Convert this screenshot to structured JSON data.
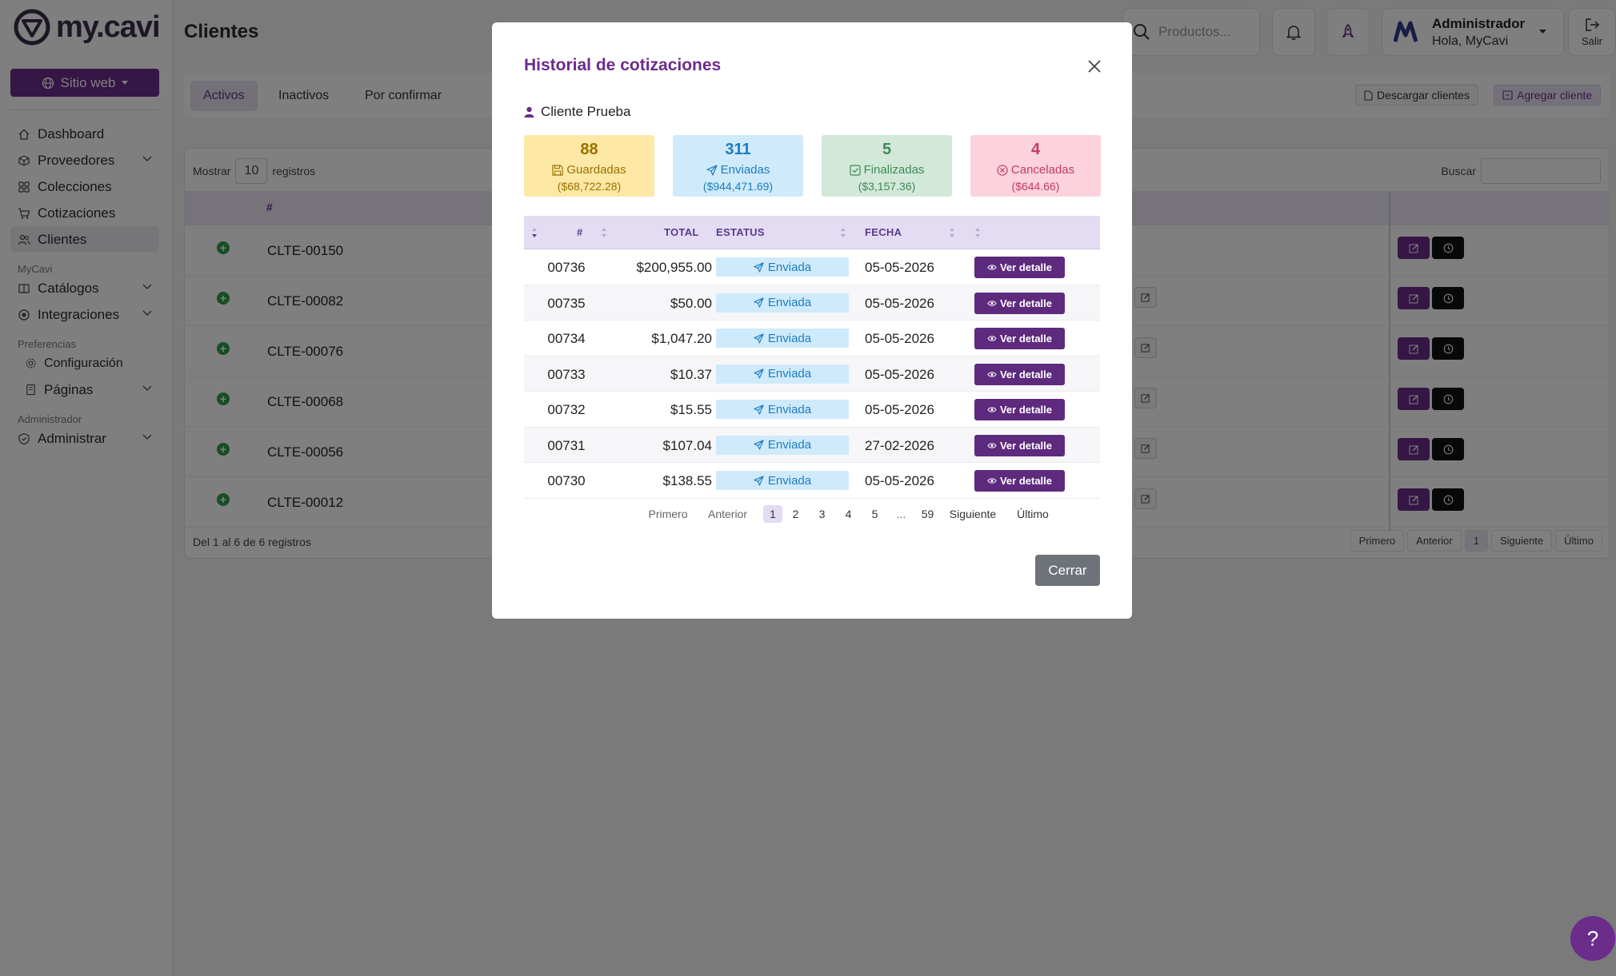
{
  "brand": {
    "logo_text": "my.cavi",
    "accent": "#6b2c8a"
  },
  "sidebar": {
    "site_button": "Sitio web",
    "items": [
      {
        "label": "Dashboard",
        "icon": "home-icon"
      },
      {
        "label": "Proveedores",
        "icon": "box-icon",
        "expandable": true
      },
      {
        "label": "Colecciones",
        "icon": "grid-icon"
      },
      {
        "label": "Cotizaciones",
        "icon": "cart-icon"
      },
      {
        "label": "Clientes",
        "icon": "users-icon",
        "active": true
      }
    ],
    "section_mycavi": "MyCavi",
    "mycavi_items": [
      {
        "label": "Catálogos",
        "icon": "book-icon",
        "expandable": true
      },
      {
        "label": "Integraciones",
        "icon": "plug-icon",
        "expandable": true
      }
    ],
    "section_prefs": "Preferencias",
    "prefs_items": [
      {
        "label": "Configuración",
        "icon": "gear-icon"
      },
      {
        "label": "Páginas",
        "icon": "page-icon",
        "expandable": true
      }
    ],
    "section_admin": "Administrador",
    "admin_items": [
      {
        "label": "Administrar",
        "icon": "shield-icon",
        "expandable": true
      }
    ]
  },
  "header": {
    "title": "Clientes",
    "search_placeholder": "Productos...",
    "user_name": "Administrador",
    "user_greeting": "Hola, MyCavi",
    "logout_label": "Salir"
  },
  "background": {
    "tabs": [
      "Activos",
      "Inactivos",
      "Por confirmar"
    ],
    "download_button": "Descargar clientes",
    "add_button": "Agregar cliente",
    "show_label": "Mostrar",
    "show_value": "10",
    "records_label": "registros",
    "search_label": "Buscar",
    "col_hash": "#",
    "rows": [
      "CLTE-00150",
      "CLTE-00082",
      "CLTE-00076",
      "CLTE-00068",
      "CLTE-00056",
      "CLTE-00012"
    ],
    "footer": "Del 1 al 6 de 6 registros",
    "pager": [
      "Primero",
      "Anterior",
      "1",
      "Siguiente",
      "Último"
    ]
  },
  "modal": {
    "title": "Historial de cotizaciones",
    "client": "Cliente Prueba",
    "stats": [
      {
        "count": "88",
        "label": "Guardadas",
        "amount": "($68,722.28)",
        "icon": "save-icon",
        "style": "yellow"
      },
      {
        "count": "311",
        "label": "Enviadas",
        "amount": "($944,471.69)",
        "icon": "send-icon",
        "style": "blue"
      },
      {
        "count": "5",
        "label": "Finalizadas",
        "amount": "($3,157.36)",
        "icon": "check-icon",
        "style": "green"
      },
      {
        "count": "4",
        "label": "Canceladas",
        "amount": "($644.66)",
        "icon": "cancel-icon",
        "style": "pink"
      }
    ],
    "columns": {
      "num": "#",
      "total": "TOTAL",
      "status": "ESTATUS",
      "date": "FECHA"
    },
    "rows": [
      {
        "num": "00736",
        "total": "$200,955.00",
        "status": "Enviada",
        "date": "05-05-2026",
        "action": "Ver detalle"
      },
      {
        "num": "00735",
        "total": "$50.00",
        "status": "Enviada",
        "date": "05-05-2026",
        "action": "Ver detalle"
      },
      {
        "num": "00734",
        "total": "$1,047.20",
        "status": "Enviada",
        "date": "05-05-2026",
        "action": "Ver detalle"
      },
      {
        "num": "00733",
        "total": "$10.37",
        "status": "Enviada",
        "date": "05-05-2026",
        "action": "Ver detalle"
      },
      {
        "num": "00732",
        "total": "$15.55",
        "status": "Enviada",
        "date": "05-05-2026",
        "action": "Ver detalle"
      },
      {
        "num": "00731",
        "total": "$107.04",
        "status": "Enviada",
        "date": "27-02-2026",
        "action": "Ver detalle"
      },
      {
        "num": "00730",
        "total": "$138.55",
        "status": "Enviada",
        "date": "05-05-2026",
        "action": "Ver detalle"
      }
    ],
    "pager": {
      "first": "Primero",
      "prev": "Anterior",
      "pages": [
        "1",
        "2",
        "3",
        "4",
        "5",
        "...",
        "59"
      ],
      "current": "1",
      "next": "Siguiente",
      "last": "Último"
    },
    "close_button": "Cerrar"
  },
  "help_label": "?"
}
